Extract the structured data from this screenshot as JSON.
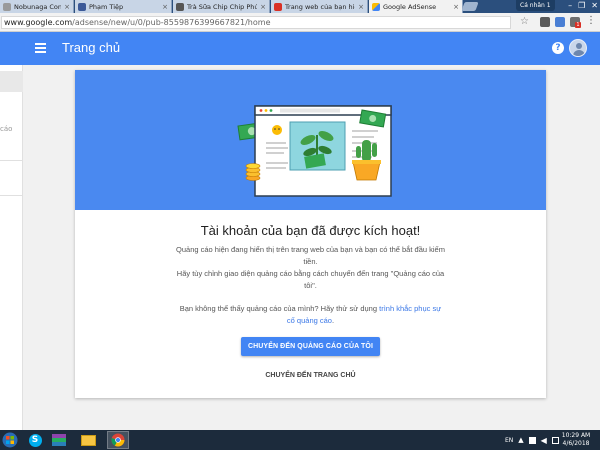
{
  "browser": {
    "tabs": [
      {
        "label": "Nobunaga Concerto - ",
        "favicon": "page-icon"
      },
      {
        "label": "Phạm Tiệp",
        "favicon": "facebook-icon"
      },
      {
        "label": "Trà Sữa Chip Chip Phú C",
        "favicon": "page-icon"
      },
      {
        "label": "Trang web của bạn hiện",
        "favicon": "gmail-icon"
      },
      {
        "label": "Google AdSense",
        "favicon": "adsense-icon",
        "active": true
      }
    ],
    "user_badge": "Cá nhân 1",
    "url_host": "www.google.com",
    "url_path": "/adsense/new/u/0/pub-8559876399667821/home",
    "notification_count": "1"
  },
  "appbar": {
    "title": "Trang chủ",
    "help_label": "?",
    "color": "#4285f4"
  },
  "sidebar": {
    "fragment": "cáo"
  },
  "card": {
    "title": "Tài khoản của bạn đã được kích hoạt!",
    "line1": "Quảng cáo hiện đang hiển thị trên trang web của bạn và bạn có thể bắt đầu kiếm tiền.",
    "line2": "Hãy tùy chỉnh giao diện quảng cáo bằng cách chuyển đến trang \"Quảng cáo của tôi\".",
    "help_text": "Bạn không thể thấy quảng cáo của mình? Hãy thử sử dụng",
    "help_link": "trình khắc phục sự cố quảng cáo",
    "help_end": ".",
    "primary_button": "CHUYỂN ĐẾN QUẢNG CÁO CỦA TÔI",
    "secondary_button": "CHUYỂN ĐẾN TRANG CHỦ"
  },
  "taskbar": {
    "language": "EN",
    "time": "10:29 AM",
    "date": "4/6/2018"
  }
}
